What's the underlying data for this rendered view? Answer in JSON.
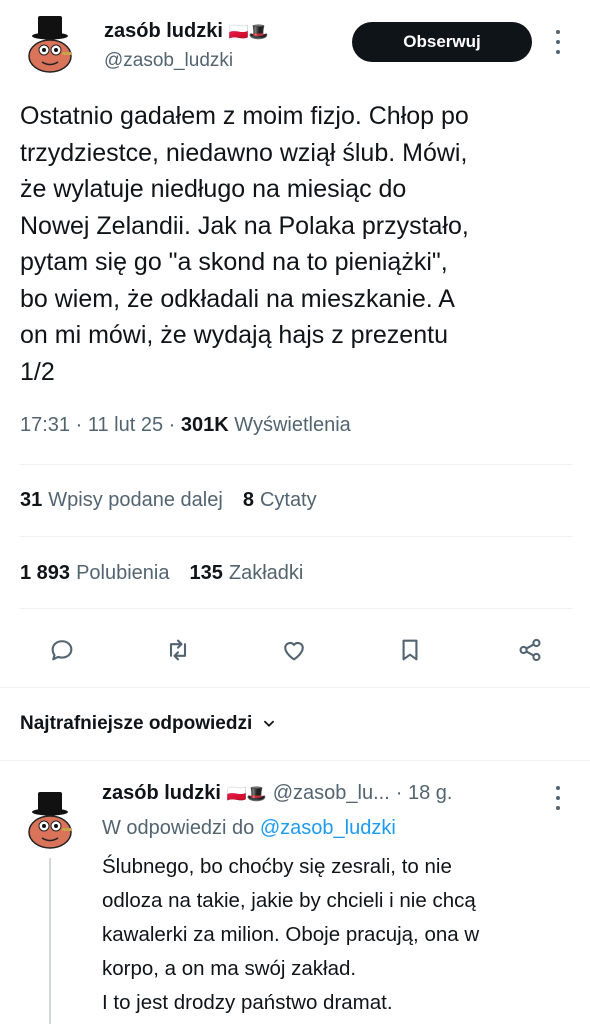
{
  "author": {
    "display_name": "zasób ludzki",
    "emoji": "🇵🇱🎩",
    "handle": "@zasob_ludzki",
    "avatar_icon": "top-hat-character-avatar"
  },
  "follow_button": {
    "label": "Obserwuj"
  },
  "tweet": {
    "text": "Ostatnio gadałem z moim fizjo. Chłop po\ntrzydziestce, niedawno wziął ślub. Mówi,\nże wylatuje niedługo na miesiąc do\nNowej Zelandii. Jak na Polaka przystało,\npytam się go \"a skond na to pieniążki\",\nbo wiem, że odkładali na mieszkanie. A\non mi mówi, że wydają hajs z prezentu\n1/2",
    "time": "17:31",
    "date": "11 lut 25",
    "views_count": "301K",
    "views_label": "Wyświetlenia"
  },
  "stats": {
    "retweets_count": "31",
    "retweets_label": "Wpisy podane dalej",
    "quotes_count": "8",
    "quotes_label": "Cytaty",
    "likes_count": "1 893",
    "likes_label": "Polubienia",
    "bookmarks_count": "135",
    "bookmarks_label": "Zakładki"
  },
  "actions": [
    "reply-icon",
    "retweet-icon",
    "like-icon",
    "bookmark-icon",
    "share-icon"
  ],
  "replies_header": {
    "label": "Najtrafniejsze odpowiedzi"
  },
  "reply": {
    "display_name": "zasób ludzki",
    "emoji": "🇵🇱🎩",
    "handle": "@zasob_lu...",
    "time": "· 18 g.",
    "replying_to_label": "W odpowiedzi do",
    "replying_to_handle": "@zasob_ludzki",
    "text": "Ślubnego, bo choćby się zesrali, to nie\nodloza na takie, jakie by chcieli i nie chcą\nkawalerki za milion. Oboje pracują, ona w\nkorpo, a on ma swój zakład.\nI to jest drodzy państwo dramat."
  },
  "colors": {
    "text": "#0f1419",
    "secondary": "#536471",
    "link": "#1d9bf0",
    "divider": "#eff3f4"
  }
}
